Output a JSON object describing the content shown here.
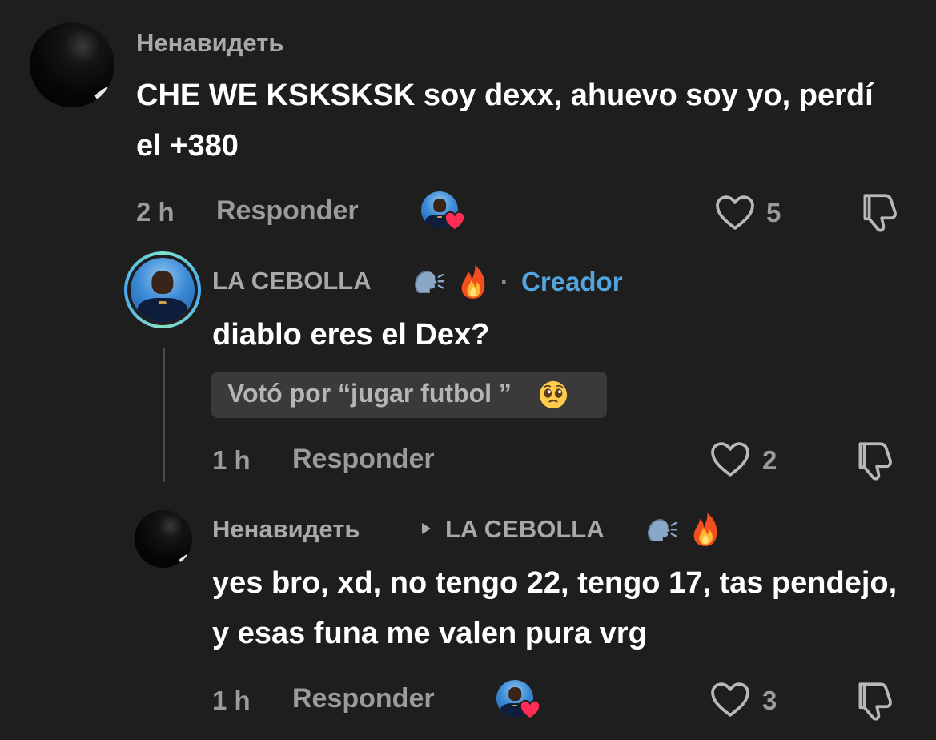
{
  "comments": [
    {
      "username": "Ненавидеть",
      "text": "CHE WE KSKSKSK soy dexx, ahuevo soy yo, perdí el +380",
      "time": "2 h",
      "reply_label": "Responder",
      "likes": "5"
    },
    {
      "username": "LA CEBOLLA",
      "separator": "·",
      "creator_label": "Creador",
      "text": "diablo eres el Dex?",
      "vote": "Votó por “jugar futbol ”",
      "time": "1 h",
      "reply_label": "Responder",
      "likes": "2"
    },
    {
      "username": "Ненавидеть",
      "reply_to": "LA CEBOLLA",
      "text": "yes bro, xd, no tengo 22, tengo 17, tas pendejo, y esas funa me valen pura vrg",
      "time": "1 h",
      "reply_label": "Responder",
      "likes": "3"
    }
  ],
  "icons": {
    "like": "heart-outline-icon",
    "dislike": "thumbs-down-icon",
    "creator_liked": "creator-heart-avatar-icon",
    "speaking": "speaking-head-emoji",
    "fire": "fire-emoji",
    "pleading": "pleading-face-emoji",
    "reply_arrow": "play-triangle-icon"
  },
  "colors": {
    "background": "#1e1e1e",
    "creator_blue": "#52a5e0",
    "muted_text": "#9b9b9b",
    "heart_red": "#ff2d55"
  }
}
